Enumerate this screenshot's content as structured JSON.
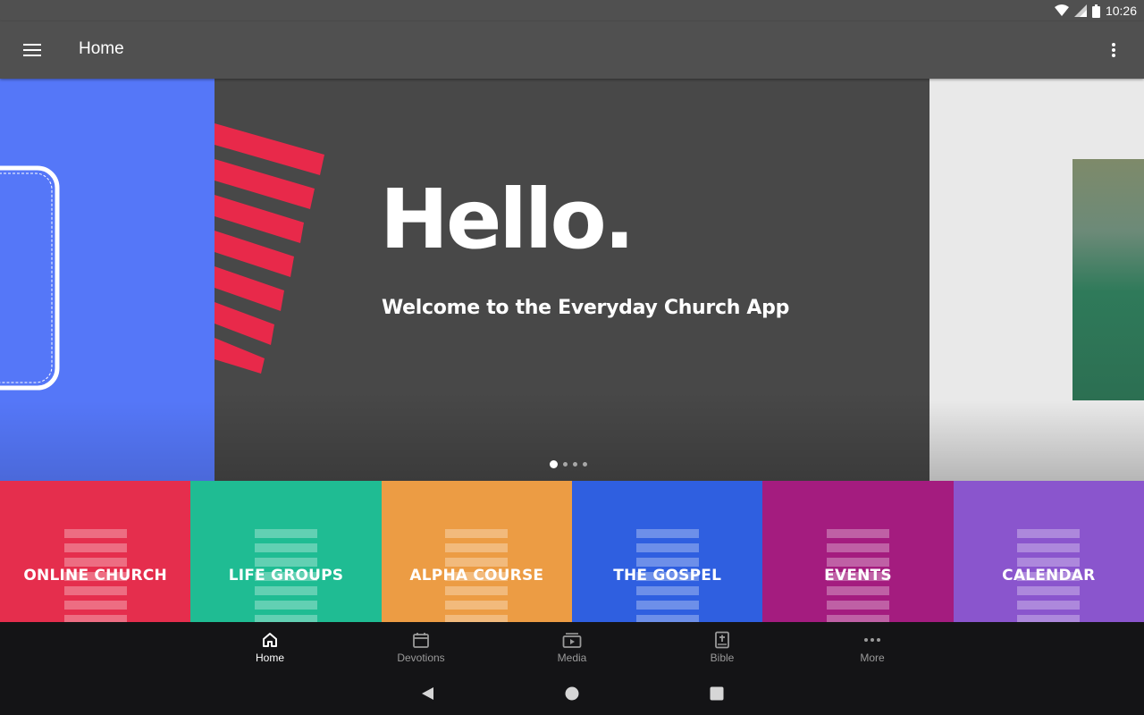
{
  "status_bar": {
    "time": "10:26",
    "icons": [
      "wifi-icon",
      "signal-icon",
      "battery-icon"
    ]
  },
  "app_bar": {
    "title": "Home",
    "menu_icon": "hamburger-menu-icon",
    "overflow_icon": "more-vert-icon"
  },
  "carousel": {
    "heading": "Hello.",
    "subheading": "Welcome to the Everyday Church App",
    "slide_count": 4,
    "active_slide": 1,
    "colors": {
      "left_slide": "#5577f8",
      "main_slide": "#484848",
      "stripes": "#e8294a",
      "right_slide": "#e9e9e9"
    }
  },
  "tiles": [
    {
      "label": "ONLINE CHURCH",
      "color": "#e52e4d"
    },
    {
      "label": "LIFE GROUPS",
      "color": "#1fbc93"
    },
    {
      "label": "ALPHA COURSE",
      "color": "#ec9c44"
    },
    {
      "label": "THE GOSPEL",
      "color": "#2f5fe0"
    },
    {
      "label": "EVENTS",
      "color": "#a41c7f"
    },
    {
      "label": "CALENDAR",
      "color": "#8a55cd"
    }
  ],
  "bottom_nav": {
    "items": [
      {
        "label": "Home",
        "icon": "home-icon",
        "active": true
      },
      {
        "label": "Devotions",
        "icon": "calendar-icon",
        "active": false
      },
      {
        "label": "Media",
        "icon": "media-icon",
        "active": false
      },
      {
        "label": "Bible",
        "icon": "bible-icon",
        "active": false
      },
      {
        "label": "More",
        "icon": "more-horiz-icon",
        "active": false
      }
    ]
  },
  "system_nav": {
    "buttons": [
      "back-icon",
      "home-circle-icon",
      "recents-icon"
    ]
  }
}
